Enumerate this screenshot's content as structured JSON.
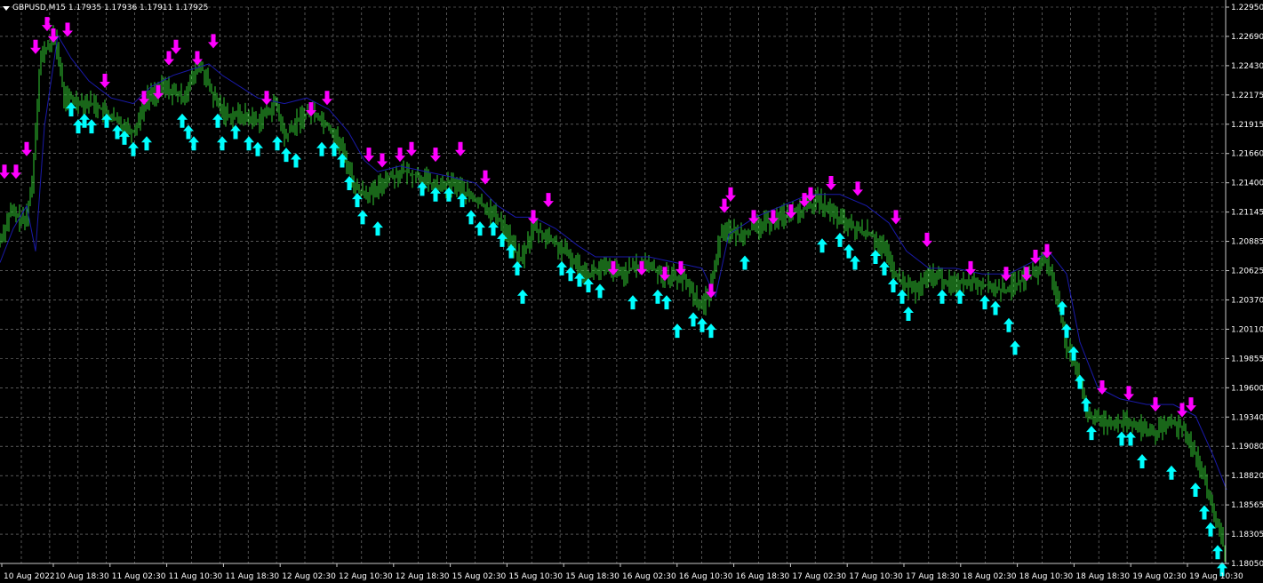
{
  "header": {
    "symbol": "GBPUSD,M15",
    "ohlc": "1.17935 1.17936 1.17911 1.17925"
  },
  "colors": {
    "background": "#000000",
    "grid": "#8a8a8a",
    "axis": "#c8c8c8",
    "candles": "#32cd32",
    "ma_line": "#1a1aaa",
    "up_arrow": "#00ffff",
    "down_arrow": "#ff00ff"
  },
  "icons": {
    "buy_signal": "up-arrow-icon",
    "sell_signal": "down-arrow-icon"
  },
  "chart_data": {
    "type": "candlestick",
    "symbol": "GBPUSD",
    "timeframe": "M15",
    "ylim": [
      1.1805,
      1.2295
    ],
    "y_ticks": [
      "1.22950",
      "1.22690",
      "1.22430",
      "1.22175",
      "1.21915",
      "1.21660",
      "1.21400",
      "1.21145",
      "1.20885",
      "1.20625",
      "1.20370",
      "1.20110",
      "1.19855",
      "1.19600",
      "1.19340",
      "1.19080",
      "1.18820",
      "1.18565",
      "1.18305",
      "1.18050"
    ],
    "x_ticks": [
      "10 Aug 2022",
      "10 Aug 18:30",
      "11 Aug 02:30",
      "11 Aug 10:30",
      "11 Aug 18:30",
      "12 Aug 02:30",
      "12 Aug 10:30",
      "12 Aug 18:30",
      "15 Aug 02:30",
      "15 Aug 10:30",
      "15 Aug 18:30",
      "16 Aug 02:30",
      "16 Aug 10:30",
      "16 Aug 18:30",
      "17 Aug 02:30",
      "17 Aug 10:30",
      "17 Aug 18:30",
      "18 Aug 02:30",
      "18 Aug 10:30",
      "18 Aug 18:30",
      "19 Aug 02:30",
      "19 Aug 10:30"
    ],
    "bar_count": 690,
    "price_path": [
      [
        0,
        1.209
      ],
      [
        12,
        1.2115
      ],
      [
        28,
        1.2105
      ],
      [
        36,
        1.214
      ],
      [
        45,
        1.225
      ],
      [
        62,
        1.227
      ],
      [
        72,
        1.2215
      ],
      [
        105,
        1.221
      ],
      [
        130,
        1.2195
      ],
      [
        150,
        1.2185
      ],
      [
        165,
        1.2215
      ],
      [
        185,
        1.2225
      ],
      [
        205,
        1.2215
      ],
      [
        225,
        1.2245
      ],
      [
        240,
        1.2215
      ],
      [
        255,
        1.22
      ],
      [
        270,
        1.22
      ],
      [
        290,
        1.2195
      ],
      [
        310,
        1.221
      ],
      [
        320,
        1.218
      ],
      [
        335,
        1.2195
      ],
      [
        350,
        1.2205
      ],
      [
        370,
        1.219
      ],
      [
        385,
        1.217
      ],
      [
        400,
        1.2135
      ],
      [
        420,
        1.213
      ],
      [
        435,
        1.2145
      ],
      [
        455,
        1.215
      ],
      [
        475,
        1.2145
      ],
      [
        490,
        1.2135
      ],
      [
        510,
        1.214
      ],
      [
        525,
        1.213
      ],
      [
        545,
        1.212
      ],
      [
        565,
        1.2105
      ],
      [
        585,
        1.207
      ],
      [
        600,
        1.21
      ],
      [
        620,
        1.209
      ],
      [
        640,
        1.2075
      ],
      [
        660,
        1.206
      ],
      [
        680,
        1.2065
      ],
      [
        700,
        1.206
      ],
      [
        725,
        1.207
      ],
      [
        745,
        1.206
      ],
      [
        770,
        1.2055
      ],
      [
        790,
        1.203
      ],
      [
        800,
        1.205
      ],
      [
        812,
        1.21
      ],
      [
        830,
        1.2095
      ],
      [
        850,
        1.21
      ],
      [
        875,
        1.211
      ],
      [
        900,
        1.2115
      ],
      [
        920,
        1.2125
      ],
      [
        940,
        1.211
      ],
      [
        960,
        1.21
      ],
      [
        980,
        1.2095
      ],
      [
        995,
        1.208
      ],
      [
        1010,
        1.2055
      ],
      [
        1030,
        1.2045
      ],
      [
        1050,
        1.206
      ],
      [
        1070,
        1.205
      ],
      [
        1090,
        1.2055
      ],
      [
        1110,
        1.205
      ],
      [
        1130,
        1.2045
      ],
      [
        1150,
        1.2055
      ],
      [
        1165,
        1.206
      ],
      [
        1175,
        1.2075
      ],
      [
        1190,
        1.204
      ],
      [
        1200,
        1.1995
      ],
      [
        1215,
        1.1965
      ],
      [
        1225,
        1.1935
      ],
      [
        1240,
        1.193
      ],
      [
        1260,
        1.193
      ],
      [
        1280,
        1.1925
      ],
      [
        1300,
        1.192
      ],
      [
        1320,
        1.193
      ],
      [
        1335,
        1.192
      ],
      [
        1350,
        1.189
      ],
      [
        1365,
        1.185
      ],
      [
        1380,
        1.181
      ]
    ],
    "ma_path": [
      [
        0,
        1.207
      ],
      [
        15,
        1.21
      ],
      [
        30,
        1.212
      ],
      [
        40,
        1.208
      ],
      [
        50,
        1.219
      ],
      [
        65,
        1.227
      ],
      [
        80,
        1.225
      ],
      [
        100,
        1.223
      ],
      [
        125,
        1.2215
      ],
      [
        150,
        1.221
      ],
      [
        170,
        1.2225
      ],
      [
        195,
        1.2235
      ],
      [
        215,
        1.224
      ],
      [
        235,
        1.2245
      ],
      [
        250,
        1.2235
      ],
      [
        270,
        1.2225
      ],
      [
        290,
        1.2215
      ],
      [
        320,
        1.221
      ],
      [
        345,
        1.2215
      ],
      [
        370,
        1.2205
      ],
      [
        392,
        1.2185
      ],
      [
        410,
        1.216
      ],
      [
        425,
        1.215
      ],
      [
        450,
        1.2155
      ],
      [
        480,
        1.215
      ],
      [
        510,
        1.2145
      ],
      [
        535,
        1.214
      ],
      [
        560,
        1.212
      ],
      [
        580,
        1.211
      ],
      [
        600,
        1.211
      ],
      [
        625,
        1.21
      ],
      [
        650,
        1.2085
      ],
      [
        670,
        1.2075
      ],
      [
        700,
        1.2075
      ],
      [
        730,
        1.2075
      ],
      [
        760,
        1.207
      ],
      [
        790,
        1.2065
      ],
      [
        805,
        1.204
      ],
      [
        820,
        1.2095
      ],
      [
        850,
        1.211
      ],
      [
        880,
        1.212
      ],
      [
        910,
        1.213
      ],
      [
        945,
        1.213
      ],
      [
        975,
        1.212
      ],
      [
        1000,
        1.2105
      ],
      [
        1020,
        1.208
      ],
      [
        1045,
        1.2065
      ],
      [
        1075,
        1.2065
      ],
      [
        1105,
        1.206
      ],
      [
        1135,
        1.206
      ],
      [
        1160,
        1.207
      ],
      [
        1180,
        1.208
      ],
      [
        1200,
        1.206
      ],
      [
        1215,
        1.2
      ],
      [
        1235,
        1.196
      ],
      [
        1260,
        1.195
      ],
      [
        1290,
        1.1945
      ],
      [
        1320,
        1.1945
      ],
      [
        1345,
        1.1935
      ],
      [
        1365,
        1.19
      ],
      [
        1380,
        1.187
      ]
    ],
    "up_arrows": [
      [
        80,
        1.2205
      ],
      [
        88,
        1.219
      ],
      [
        95,
        1.2195
      ],
      [
        103,
        1.219
      ],
      [
        120,
        1.2195
      ],
      [
        132,
        1.2185
      ],
      [
        140,
        1.218
      ],
      [
        150,
        1.217
      ],
      [
        165,
        1.2175
      ],
      [
        205,
        1.2195
      ],
      [
        212,
        1.2185
      ],
      [
        218,
        1.2175
      ],
      [
        245,
        1.2195
      ],
      [
        250,
        1.2175
      ],
      [
        265,
        1.2185
      ],
      [
        280,
        1.2175
      ],
      [
        290,
        1.217
      ],
      [
        312,
        1.2175
      ],
      [
        322,
        1.2165
      ],
      [
        333,
        1.216
      ],
      [
        362,
        1.217
      ],
      [
        376,
        1.217
      ],
      [
        385,
        1.216
      ],
      [
        393,
        1.214
      ],
      [
        402,
        1.2125
      ],
      [
        408,
        1.211
      ],
      [
        425,
        1.21
      ],
      [
        475,
        1.2135
      ],
      [
        490,
        1.213
      ],
      [
        505,
        1.213
      ],
      [
        520,
        1.2125
      ],
      [
        530,
        1.211
      ],
      [
        540,
        1.21
      ],
      [
        555,
        1.21
      ],
      [
        565,
        1.209
      ],
      [
        575,
        1.208
      ],
      [
        582,
        1.2065
      ],
      [
        588,
        1.204
      ],
      [
        632,
        1.2065
      ],
      [
        642,
        1.206
      ],
      [
        652,
        1.2055
      ],
      [
        662,
        1.205
      ],
      [
        675,
        1.2045
      ],
      [
        712,
        1.2035
      ],
      [
        740,
        1.204
      ],
      [
        750,
        1.2035
      ],
      [
        762,
        1.201
      ],
      [
        780,
        1.202
      ],
      [
        790,
        1.2015
      ],
      [
        800,
        1.201
      ],
      [
        838,
        1.207
      ],
      [
        925,
        1.2085
      ],
      [
        945,
        1.209
      ],
      [
        955,
        1.208
      ],
      [
        962,
        1.207
      ],
      [
        985,
        1.2075
      ],
      [
        995,
        1.2065
      ],
      [
        1005,
        1.205
      ],
      [
        1015,
        1.204
      ],
      [
        1022,
        1.2025
      ],
      [
        1060,
        1.204
      ],
      [
        1080,
        1.204
      ],
      [
        1108,
        1.2035
      ],
      [
        1120,
        1.203
      ],
      [
        1135,
        1.2015
      ],
      [
        1142,
        1.1995
      ],
      [
        1195,
        1.203
      ],
      [
        1200,
        1.201
      ],
      [
        1208,
        1.199
      ],
      [
        1215,
        1.1965
      ],
      [
        1222,
        1.1945
      ],
      [
        1228,
        1.192
      ],
      [
        1262,
        1.1915
      ],
      [
        1272,
        1.1915
      ],
      [
        1285,
        1.1895
      ],
      [
        1318,
        1.1885
      ],
      [
        1345,
        1.187
      ],
      [
        1355,
        1.185
      ],
      [
        1362,
        1.1835
      ],
      [
        1370,
        1.1815
      ],
      [
        1375,
        1.18
      ]
    ],
    "down_arrows": [
      [
        5,
        1.215
      ],
      [
        18,
        1.215
      ],
      [
        30,
        1.217
      ],
      [
        40,
        1.226
      ],
      [
        53,
        1.228
      ],
      [
        60,
        1.227
      ],
      [
        76,
        1.2275
      ],
      [
        118,
        1.223
      ],
      [
        162,
        1.2215
      ],
      [
        178,
        1.222
      ],
      [
        190,
        1.225
      ],
      [
        198,
        1.226
      ],
      [
        222,
        1.225
      ],
      [
        240,
        1.2265
      ],
      [
        300,
        1.2215
      ],
      [
        350,
        1.2205
      ],
      [
        368,
        1.2215
      ],
      [
        415,
        1.2165
      ],
      [
        430,
        1.216
      ],
      [
        450,
        1.2165
      ],
      [
        463,
        1.217
      ],
      [
        490,
        1.2165
      ],
      [
        518,
        1.217
      ],
      [
        546,
        1.2145
      ],
      [
        600,
        1.211
      ],
      [
        617,
        1.2125
      ],
      [
        690,
        1.2065
      ],
      [
        722,
        1.2065
      ],
      [
        748,
        1.206
      ],
      [
        766,
        1.2065
      ],
      [
        800,
        1.2045
      ],
      [
        815,
        1.212
      ],
      [
        822,
        1.213
      ],
      [
        848,
        1.211
      ],
      [
        870,
        1.211
      ],
      [
        890,
        1.2115
      ],
      [
        905,
        1.2125
      ],
      [
        912,
        1.213
      ],
      [
        935,
        1.214
      ],
      [
        965,
        1.2135
      ],
      [
        1008,
        1.211
      ],
      [
        1043,
        1.209
      ],
      [
        1092,
        1.2065
      ],
      [
        1132,
        1.206
      ],
      [
        1155,
        1.206
      ],
      [
        1165,
        1.2075
      ],
      [
        1178,
        1.208
      ],
      [
        1240,
        1.196
      ],
      [
        1270,
        1.1955
      ],
      [
        1300,
        1.1945
      ],
      [
        1330,
        1.194
      ],
      [
        1340,
        1.1945
      ]
    ]
  }
}
